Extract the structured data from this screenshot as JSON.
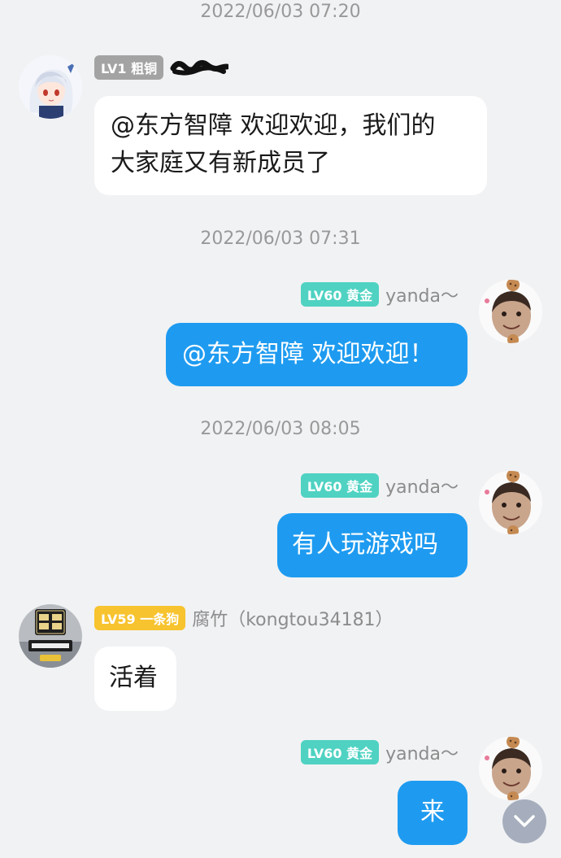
{
  "messages": [
    {
      "timestamp": "2022/06/03 07:20",
      "direction": "in",
      "level": "LV1 粗铜",
      "sender": "",
      "text_lines": [
        "@东方智障 欢迎欢迎，我们的",
        "大家庭又有新成员了"
      ]
    },
    {
      "timestamp": "2022/06/03 07:31",
      "direction": "out",
      "level": "LV60 黄金",
      "sender": "yanda～",
      "text": "@东方智障 欢迎欢迎！"
    },
    {
      "timestamp": "2022/06/03 08:05",
      "direction": "out",
      "level": "LV60 黄金",
      "sender": "yanda～",
      "text": "有人玩游戏吗"
    },
    {
      "timestamp": "",
      "direction": "in",
      "level": "LV59 一条狗",
      "sender": "腐竹（kongtou34181）",
      "text": "活着"
    },
    {
      "timestamp": "",
      "direction": "out",
      "level": "LV60 黄金",
      "sender": "yanda～",
      "text": "来"
    }
  ],
  "icons": {
    "scroll_down": "chevron-down-icon",
    "anime_avatar": "anime-girl-avatar",
    "self_avatar": "cookie-face-avatar",
    "game_avatar": "game-sign-avatar"
  },
  "colors": {
    "outgoing_bubble": "#1e9bf0",
    "incoming_bubble": "#ffffff",
    "background": "#f1f2f4",
    "badge_gray": "#a3a3a3",
    "badge_teal": "#4fd2c2",
    "badge_gold": "#f7c32e"
  }
}
